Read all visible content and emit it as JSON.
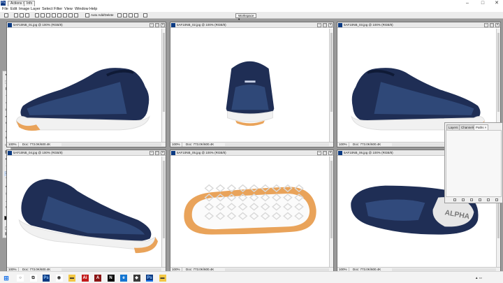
{
  "titlebar": {
    "app_icon_text": "Ps",
    "tab_actions": "Actions ×",
    "tab_info": "Info"
  },
  "menubar": {
    "items": [
      "File",
      "Edit",
      "Image",
      "Layer",
      "Select",
      "Filter",
      "View",
      "Window",
      "Help"
    ]
  },
  "options_bar": {
    "auto_select_label": "Auto Add/Delete",
    "workspace_label": "Workspace ▾"
  },
  "documents": [
    {
      "title": "5AF10NB_01.jpg @ 100% (RGB/8)",
      "zoom": "100%",
      "doc_info": "Doc: 773.0K/600.4K",
      "view": "side-right"
    },
    {
      "title": "5AF10NB_02.jpg @ 100% (RGB/8)",
      "zoom": "100%",
      "doc_info": "Doc: 773.0K/600.4K",
      "view": "back"
    },
    {
      "title": "5AF10NB_03.jpg @ 100% (RGB/8)",
      "zoom": "100%",
      "doc_info": "Doc: 773.0K/600.4K",
      "view": "side-left"
    },
    {
      "title": "5AF10NB_04.jpg @ 100% (RGB/8)",
      "zoom": "100%",
      "doc_info": "Doc: 773.0K/600.4K",
      "view": "three-quarter"
    },
    {
      "title": "5AF10NB_05.jpg @ 100% (RGB/8)",
      "zoom": "100%",
      "doc_info": "Doc: 773.0K/600.4K",
      "view": "sole"
    },
    {
      "title": "5AF10NB_06.jpg @ 100% (RGB/8)",
      "zoom": "100%",
      "doc_info": "Doc: 773.0K/600.4K",
      "view": "top",
      "insole_text": "ALPHA"
    }
  ],
  "layers_panel": {
    "tabs": [
      "Layers",
      "Channels",
      "Paths ×"
    ],
    "active_tab": "Paths ×"
  },
  "taskbar": {
    "apps": [
      "search-icon",
      "task-view-icon",
      "photoshop-icon",
      "chrome-icon",
      "file-explorer-icon",
      "acrobat-icon",
      "adobe-icon",
      "animate-icon",
      "edge-icon",
      "vpn-icon",
      "photoshop-active-icon",
      "folder-icon"
    ],
    "app_labels": [
      "",
      "",
      "Ps",
      "",
      "",
      "Ai",
      "A",
      "N",
      "",
      "",
      "Ps",
      ""
    ]
  },
  "colors": {
    "shoe_upper": "#1f2e55",
    "shoe_knit": "#3d5e96",
    "sole_white": "#f1f1f1",
    "outsole_gum": "#e9a35a",
    "ps_blue": "#0b3a82"
  }
}
